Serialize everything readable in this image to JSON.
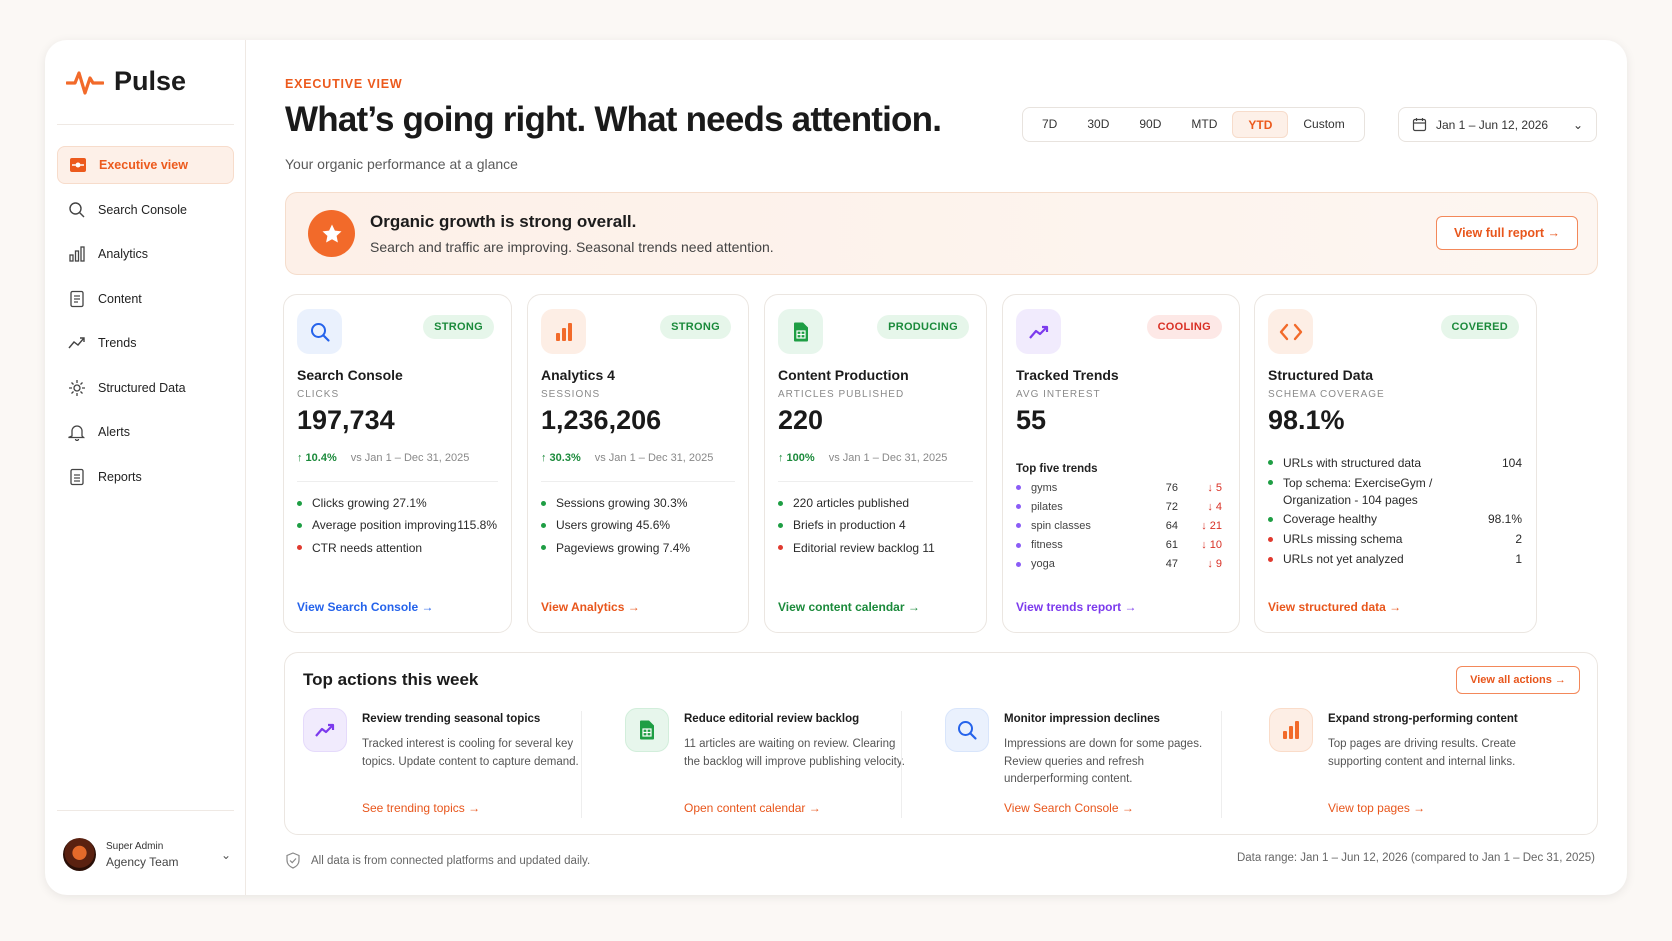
{
  "app": {
    "name": "Pulse"
  },
  "sidebar": {
    "items": [
      {
        "label": "Executive view",
        "icon": "dashboard-icon",
        "active": true
      },
      {
        "label": "Search Console",
        "icon": "search-icon"
      },
      {
        "label": "Analytics",
        "icon": "bar-chart-icon"
      },
      {
        "label": "Content",
        "icon": "document-icon"
      },
      {
        "label": "Trends",
        "icon": "trend-up-icon"
      },
      {
        "label": "Structured Data",
        "icon": "structured-data-icon"
      },
      {
        "label": "Alerts",
        "icon": "bell-icon"
      },
      {
        "label": "Reports",
        "icon": "report-icon"
      }
    ],
    "user": {
      "role": "Super Admin",
      "team": "Agency Team"
    }
  },
  "header": {
    "eyebrow": "EXECUTIVE VIEW",
    "title": "What’s  going right. What needs attention.",
    "subtitle": "Your organic performance at a glance",
    "ranges": [
      "7D",
      "30D",
      "90D",
      "MTD",
      "YTD",
      "Custom"
    ],
    "selected_range": "YTD",
    "date_range": "Jan 1 – Jun 12, 2026"
  },
  "banner": {
    "title": "Organic growth is strong overall.",
    "text": "Search and traffic are improving. Seasonal trends need attention.",
    "button": "View full report →"
  },
  "cards": [
    {
      "title": "Search Console",
      "badge": "STRONG",
      "label": "CLICKS",
      "value": "197,734",
      "delta": "↑ 10.4%",
      "compare": "vs Jan 1 – Dec 31, 2025",
      "bullets": [
        {
          "text": "Clicks growing 27.1%",
          "status": "good"
        },
        {
          "text": "Average position improving",
          "value": "115.8%",
          "status": "good"
        },
        {
          "text": "CTR needs attention",
          "status": "bad"
        }
      ],
      "link": "View Search Console →",
      "accent": "#2563eb"
    },
    {
      "title": "Analytics 4",
      "badge": "STRONG",
      "label": "SESSIONS",
      "value": "1,236,206",
      "delta": "↑ 30.3%",
      "compare": "vs Jan 1 – Dec 31, 2025",
      "bullets": [
        {
          "text": "Sessions growing 30.3%",
          "status": "good"
        },
        {
          "text": "Users growing 45.6%",
          "status": "good"
        },
        {
          "text": "Pageviews growing  7.4%",
          "status": "good"
        }
      ],
      "link": "View Analytics →",
      "accent": "#e8561c"
    },
    {
      "title": "Content Production",
      "badge": "PRODUCING",
      "label": "ARTICLES PUBLISHED",
      "value": "220",
      "delta": "↑ 100%",
      "compare": "vs Jan 1 – Dec 31, 2025",
      "bullets": [
        {
          "text": "220 articles published",
          "status": "good"
        },
        {
          "text": "Briefs in production   4",
          "status": "good"
        },
        {
          "text": "Editorial review backlog   11",
          "status": "bad"
        }
      ],
      "link": "View content calendar →",
      "accent": "#1b8a3b"
    },
    {
      "title": "Tracked Trends",
      "badge": "COOLING",
      "label": "AVG INTEREST",
      "value": "55",
      "top_label": "Top five trends",
      "trends": [
        {
          "name": "gyms",
          "value": "76",
          "change": "↓ 5"
        },
        {
          "name": "pilates",
          "value": "72",
          "change": "↓ 4"
        },
        {
          "name": "spin classes",
          "value": "64",
          "change": "↓ 21"
        },
        {
          "name": "fitness",
          "value": "61",
          "change": "↓ 10"
        },
        {
          "name": "yoga",
          "value": "47",
          "change": "↓ 9"
        }
      ],
      "link": "View trends report →",
      "accent": "#7c3aed"
    },
    {
      "title": "Structured Data",
      "badge": "COVERED",
      "label": "SCHEMA COVERAGE",
      "value": "98.1%",
      "bullets": [
        {
          "text": "URLs with structured data",
          "value": "104",
          "status": "good"
        },
        {
          "text": "Top schema:  ExerciseGym /",
          "text2": "Organization - 104 pages",
          "status": "good"
        },
        {
          "text": "Coverage healthy",
          "value": "98.1%",
          "status": "good"
        },
        {
          "text": "URLs missing schema",
          "value": "2",
          "status": "bad"
        },
        {
          "text": "URLs not yet analyzed",
          "value": "1",
          "status": "bad"
        }
      ],
      "link": "View structured data →",
      "accent": "#e8561c"
    }
  ],
  "actions": {
    "title": "Top actions this week",
    "button": "View all actions →",
    "items": [
      {
        "title": "Review trending seasonal topics",
        "text": "Tracked interest is cooling for several key topics. Update content to capture demand.",
        "link": "See trending topics →"
      },
      {
        "title": "Reduce editorial review backlog",
        "text": "11 articles are waiting on review. Clearing the backlog will improve publishing velocity.",
        "link": "Open content calendar →"
      },
      {
        "title": "Monitor impression declines",
        "text": "Impressions are down for some pages. Review queries and refresh underperforming content.",
        "link": "View Search Console →"
      },
      {
        "title": "Expand strong-performing content",
        "text": "Top pages are driving results. Create supporting content and internal links.",
        "link": "View top pages →"
      }
    ]
  },
  "footer": {
    "note": "All data is from connected platforms and updated daily.",
    "range": "Data range: Jan 1 – Jun 12, 2026 (compared to Jan 1 – Dec 31, 2025)"
  }
}
